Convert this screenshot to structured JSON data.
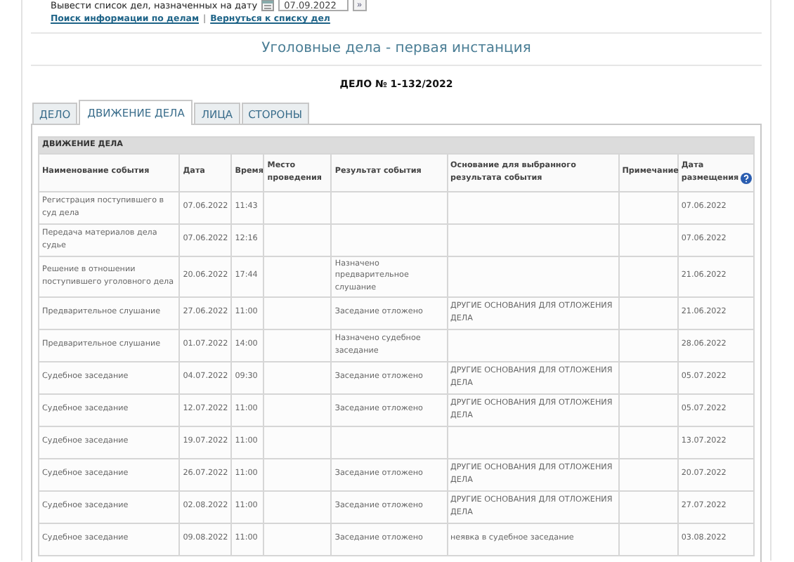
{
  "date_filter": {
    "label": "Вывести список дел, назначенных на дату",
    "value": "07.09.2022",
    "go": "»"
  },
  "links": [
    "Поиск информации по делам",
    "Вернуться к списку дел"
  ],
  "link_separator": "|",
  "heading": "Уголовные дела - первая инстанция",
  "case_number": "ДЕЛО № 1-132/2022",
  "tabs": [
    {
      "label": "ДЕЛО",
      "selected": false
    },
    {
      "label": "ДВИЖЕНИЕ ДЕЛА",
      "selected": true
    },
    {
      "label": "ЛИЦА",
      "selected": false
    },
    {
      "label": "СТОРОНЫ",
      "selected": false
    }
  ],
  "table": {
    "caption": "ДВИЖЕНИЕ ДЕЛА",
    "columns": [
      "Наименование события",
      "Дата",
      "Время",
      "Место проведения",
      "Результат события",
      "Основание для выбранного результата события",
      "Примечание",
      "Дата размещения"
    ],
    "rows": [
      [
        "Регистрация поступившего в суд дела",
        "07.06.2022",
        "11:43",
        "",
        "",
        "",
        "",
        "07.06.2022"
      ],
      [
        "Передача материалов дела судье",
        "07.06.2022",
        "12:16",
        "",
        "",
        "",
        "",
        "07.06.2022"
      ],
      [
        "Решение в отношении поступившего уголовного дела",
        "20.06.2022",
        "17:44",
        "",
        "Назначено предварительное слушание",
        "",
        "",
        "21.06.2022"
      ],
      [
        "Предварительное слушание",
        "27.06.2022",
        "11:00",
        "",
        "Заседание отложено",
        "ДРУГИЕ ОСНОВАНИЯ ДЛЯ ОТЛОЖЕНИЯ ДЕЛА",
        "",
        "21.06.2022"
      ],
      [
        "Предварительное слушание",
        "01.07.2022",
        "14:00",
        "",
        "Назначено судебное заседание",
        "",
        "",
        "28.06.2022"
      ],
      [
        "Судебное заседание",
        "04.07.2022",
        "09:30",
        "",
        "Заседание отложено",
        "ДРУГИЕ ОСНОВАНИЯ ДЛЯ ОТЛОЖЕНИЯ ДЕЛА",
        "",
        "05.07.2022"
      ],
      [
        "Судебное заседание",
        "12.07.2022",
        "11:00",
        "",
        "Заседание отложено",
        "ДРУГИЕ ОСНОВАНИЯ ДЛЯ ОТЛОЖЕНИЯ ДЕЛА",
        "",
        "05.07.2022"
      ],
      [
        "Судебное заседание",
        "19.07.2022",
        "11:00",
        "",
        "",
        "",
        "",
        "13.07.2022"
      ],
      [
        "Судебное заседание",
        "26.07.2022",
        "11:00",
        "",
        "Заседание отложено",
        "ДРУГИЕ ОСНОВАНИЯ ДЛЯ ОТЛОЖЕНИЯ ДЕЛА",
        "",
        "20.07.2022"
      ],
      [
        "Судебное заседание",
        "02.08.2022",
        "11:00",
        "",
        "Заседание отложено",
        "ДРУГИЕ ОСНОВАНИЯ ДЛЯ ОТЛОЖЕНИЯ ДЕЛА",
        "",
        "27.07.2022"
      ],
      [
        "Судебное заседание",
        "09.08.2022",
        "11:00",
        "",
        "Заседание отложено",
        "неявка в судебное заседание",
        "",
        "03.08.2022"
      ]
    ]
  }
}
